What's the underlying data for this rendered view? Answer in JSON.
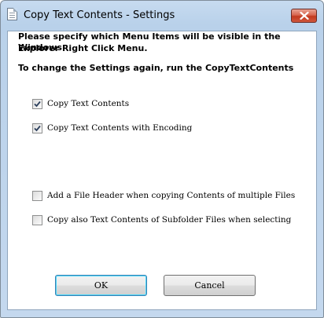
{
  "window": {
    "title": "Copy Text Contents - Settings"
  },
  "content": {
    "instruction_line1": "Please specify which Menu Items will be visible in the Windows",
    "instruction_line2": "Explorer Right Click Menu.",
    "note": "To change the Settings again, run the CopyTextContents"
  },
  "options": [
    {
      "label": "Copy Text Contents",
      "checked": true
    },
    {
      "label": "Copy Text Contents with Encoding",
      "checked": true
    },
    {
      "label": "Add a File Header when copying Contents of multiple Files",
      "checked": false
    },
    {
      "label": "Copy also Text Contents of Subfolder Files when selecting",
      "checked": false
    }
  ],
  "buttons": {
    "ok_label": "OK",
    "cancel_label": "Cancel"
  },
  "colors": {
    "title_gradient_top": "#c7dbf0",
    "close_button": "#c2391e",
    "default_button_border": "#3c7fb1"
  }
}
